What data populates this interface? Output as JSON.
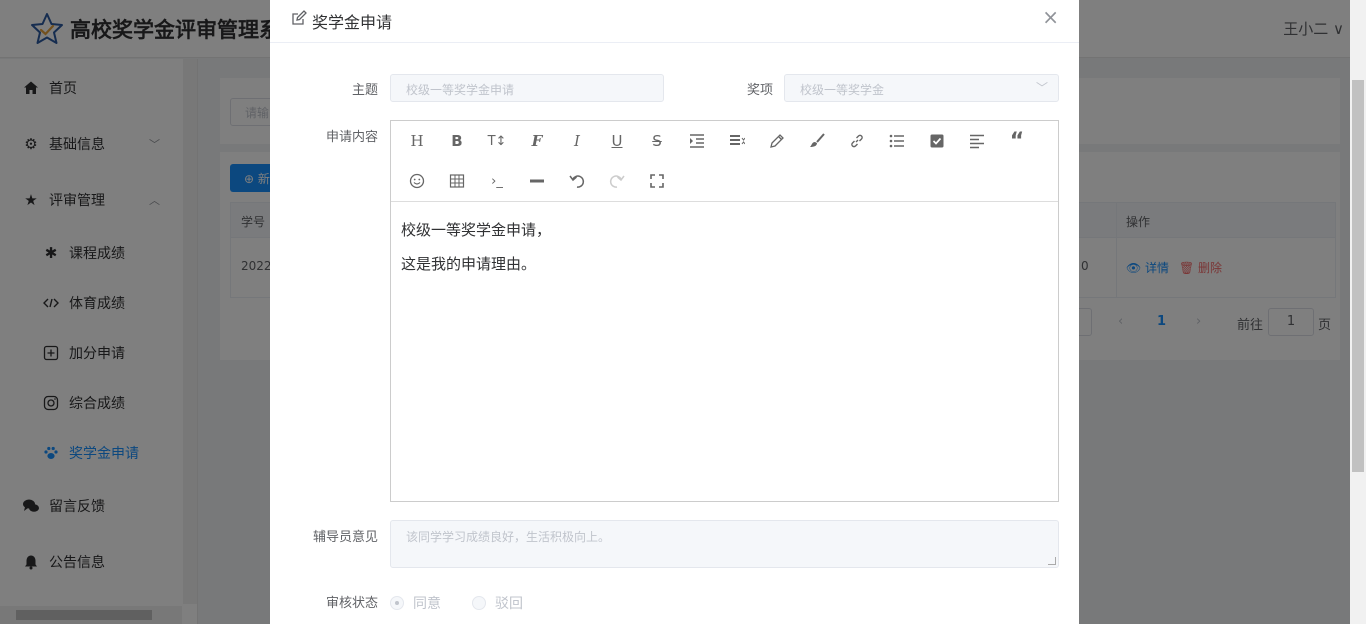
{
  "app": {
    "title": "高校奖学金评审管理系",
    "user": "王小二 ∨"
  },
  "sidebar": {
    "items": [
      {
        "label": "首页",
        "icon": "home-icon"
      },
      {
        "label": "基础信息",
        "icon": "gear-icon"
      },
      {
        "label": "评审管理",
        "icon": "star-icon"
      },
      {
        "label": "留言反馈",
        "icon": "chat-icon"
      },
      {
        "label": "公告信息",
        "icon": "bell-icon"
      }
    ],
    "sub_items": [
      {
        "label": "课程成绩",
        "icon": "yelp-icon"
      },
      {
        "label": "体育成绩",
        "icon": "code-icon"
      },
      {
        "label": "加分申请",
        "icon": "plus-square-icon"
      },
      {
        "label": "综合成绩",
        "icon": "instagram-icon"
      },
      {
        "label": "奖学金申请",
        "icon": "paw-icon"
      }
    ]
  },
  "background": {
    "search_placeholder": "请输",
    "add_label": "⊕ 新",
    "col_student_id": "学号",
    "col_actions": "操作",
    "row_student_id": "2022",
    "row_value": "0",
    "detail_label": "👁 详情",
    "delete_label": "🗑 删除",
    "pager": {
      "prev": "‹",
      "current": "1",
      "next": "›",
      "goto": "前往",
      "page_input": "1",
      "page_suffix": "页"
    }
  },
  "dialog": {
    "title": "奖学金申请",
    "close": "×",
    "subject_label": "主题",
    "subject_value": "校级一等奖学金申请",
    "award_label": "奖项",
    "award_value": "校级一等奖学金",
    "content_label": "申请内容",
    "content_lines": [
      "校级一等奖学金申请，",
      "这是我的申请理由。"
    ],
    "counselor_label": "辅导员意见",
    "counselor_value": "该同学学习成绩良好，生活积极向上。",
    "status_label": "审核状态",
    "status_options": [
      "同意",
      "驳回"
    ],
    "status_selected": "同意"
  },
  "colors": {
    "primary": "#1890ff",
    "danger": "#f56c6c",
    "overlay": "rgba(0,0,0,0.5)"
  }
}
